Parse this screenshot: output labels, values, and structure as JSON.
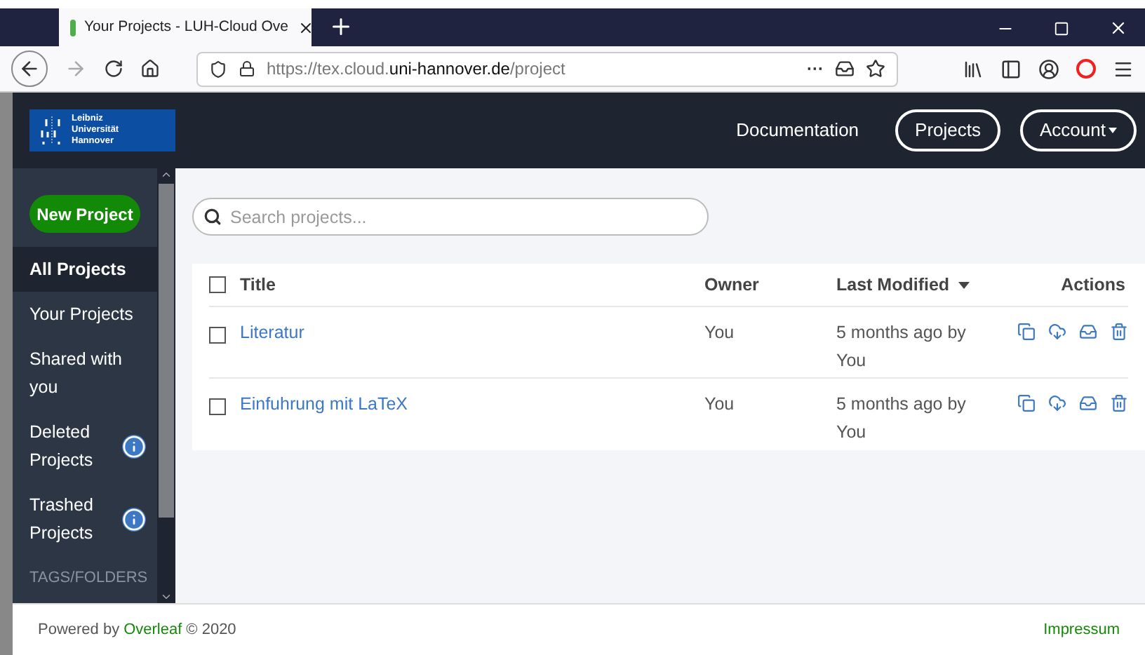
{
  "browser": {
    "tab_title": "Your Projects - LUH-Cloud Ove",
    "url_prefix": "https://tex.cloud.",
    "url_domain": "uni-hannover.de",
    "url_suffix": "/project",
    "more": "···"
  },
  "header": {
    "logo_text": [
      "Leibniz",
      "Universität",
      "Hannover"
    ],
    "nav": [
      {
        "label": "Documentation",
        "kind": "link"
      },
      {
        "label": "Projects",
        "kind": "pill"
      },
      {
        "label": "Account",
        "kind": "dropdown"
      }
    ]
  },
  "sidebar": {
    "new_button": "New Project",
    "items": [
      {
        "label": "All Projects",
        "selected": true,
        "info": false
      },
      {
        "label": "Your Projects",
        "selected": false,
        "info": false
      },
      {
        "label": "Shared with you",
        "selected": false,
        "info": false
      },
      {
        "label": "Deleted Projects",
        "selected": false,
        "info": true
      },
      {
        "label": "Trashed Projects",
        "selected": false,
        "info": true
      }
    ],
    "section": "TAGS/FOLDERS"
  },
  "search": {
    "placeholder": "Search projects..."
  },
  "table": {
    "all_checked": false,
    "columns": [
      "Title",
      "Owner",
      "Last Modified",
      "Actions"
    ],
    "rows": [
      {
        "checked": false,
        "title": "Literatur",
        "owner": "You",
        "modified": "5 months ago by You"
      },
      {
        "checked": false,
        "title": "Einfuhrung mit LaTeX",
        "owner": "You",
        "modified": "5 months ago by You"
      }
    ]
  },
  "footer": {
    "prefix": "Powered by",
    "link": "Overleaf",
    "suffix": "© 2020",
    "right_link": "Impressum"
  }
}
